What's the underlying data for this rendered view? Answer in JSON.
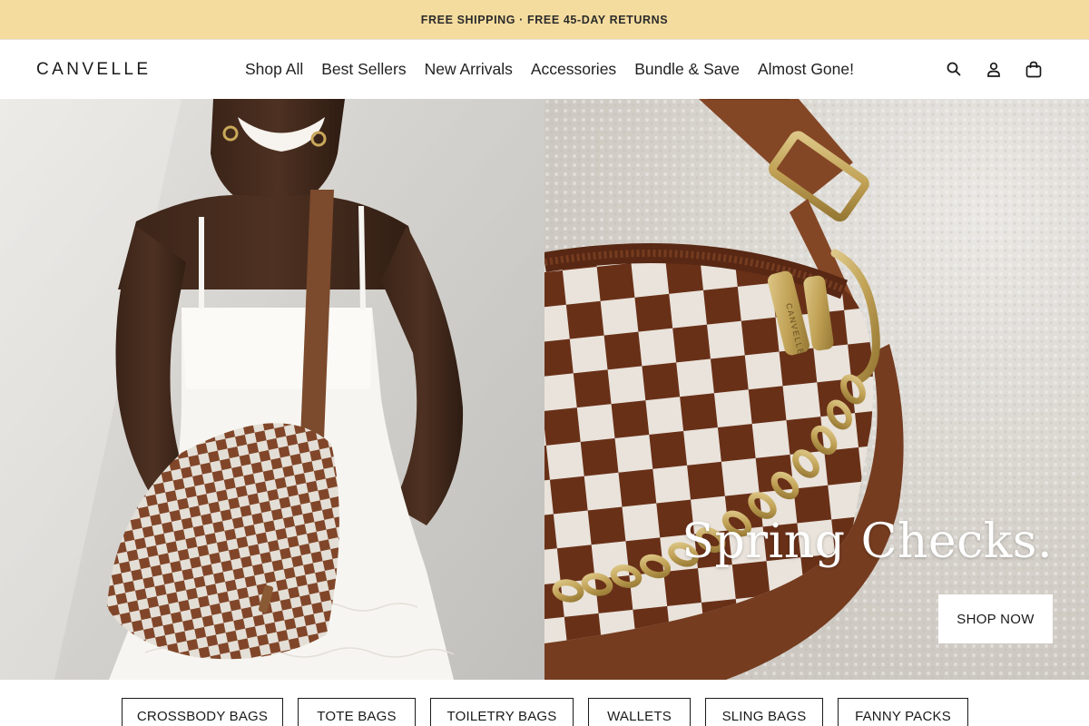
{
  "announcement": {
    "text": "FREE SHIPPING · FREE 45-DAY RETURNS"
  },
  "header": {
    "logo": "CANVELLE",
    "nav": [
      "Shop All",
      "Best Sellers",
      "New Arrivals",
      "Accessories",
      "Bundle & Save",
      "Almost Gone!"
    ],
    "icons": [
      "search-icon",
      "account-icon",
      "cart-icon"
    ]
  },
  "hero": {
    "title": "Spring Checks.",
    "cta": "SHOP NOW",
    "left_image": "model-with-checkered-hobo-bag-photo",
    "right_image": "checkered-sling-bag-with-gold-chain-photo",
    "zipper_pull_text": "CANVELLE"
  },
  "categories": [
    "CROSSBODY BAGS",
    "TOTE BAGS",
    "TOILETRY BAGS",
    "WALLETS",
    "SLING BAGS",
    "FANNY PACKS"
  ],
  "colors": {
    "announcement_bg": "#f4dc9e",
    "check_brown": "#7a3f22",
    "check_cream": "#f3ede4",
    "gold": "#c9a95a"
  }
}
